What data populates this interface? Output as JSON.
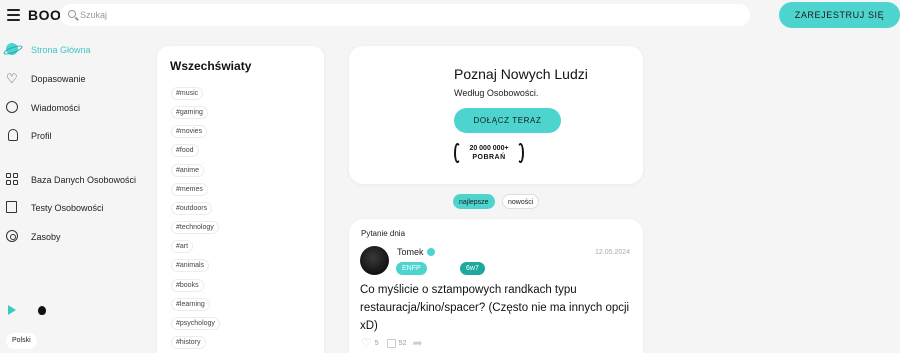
{
  "header": {
    "logo": "BOO",
    "search_placeholder": "Szukaj",
    "register_label": "ZAREJESTRUJ SIĘ"
  },
  "sidebar": {
    "items": [
      {
        "label": "Strona Główna",
        "icon": "home-planet-icon",
        "active": true
      },
      {
        "label": "Dopasowanie",
        "icon": "heart-icon"
      },
      {
        "label": "Wiadomości",
        "icon": "chat-icon"
      },
      {
        "label": "Profil",
        "icon": "bell-icon"
      },
      {
        "label": "Baza Danych Osobowości",
        "icon": "grid-icon"
      },
      {
        "label": "Testy Osobowości",
        "icon": "test-icon"
      },
      {
        "label": "Zasoby",
        "icon": "resources-icon"
      }
    ],
    "language": "Polski"
  },
  "universes": {
    "title": "Wszechświaty",
    "tags": [
      "#music",
      "#gaming",
      "#movies",
      "#food",
      "#anime",
      "#memes",
      "#outdoors",
      "#technology",
      "#art",
      "#animals",
      "#books",
      "#learning",
      "#psychology",
      "#history"
    ]
  },
  "promo": {
    "title": "Poznaj Nowych Ludzi",
    "subtitle": "Według Osobowości.",
    "join_label": "DOŁĄCZ TERAZ",
    "downloads_count": "20 000 000+",
    "downloads_label": "POBRAŃ"
  },
  "sort_tabs": [
    "najlepsze",
    "nowości"
  ],
  "question": {
    "label": "Pytanie dnia",
    "author": "Tomek",
    "date": "12.05.2024",
    "badges": [
      "ENFP",
      "6w7"
    ],
    "text": "Co myślicie o sztampowych randkach typu restauracja/kino/spacer? (Często nie ma innych opcji xD)",
    "likes": "5",
    "comments": "52"
  },
  "colors": {
    "accent": "#4ed4cf",
    "badge_enfp": "#4ed4cf",
    "badge_enneagram": "#1fa89f"
  }
}
